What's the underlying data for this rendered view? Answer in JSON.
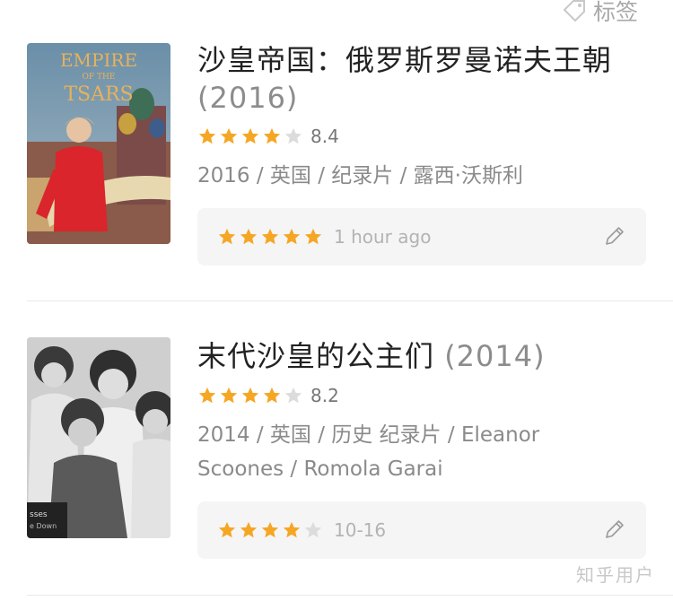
{
  "header": {
    "tag_label": "标签"
  },
  "items": [
    {
      "title": "沙皇帝国：俄罗斯罗曼诺夫王朝",
      "year": "(2016)",
      "rating_stars": 4,
      "score": "8.4",
      "meta": "2016 / 英国 / 纪录片 / 露西·沃斯利",
      "poster_text": {
        "line1": "EMPIRE",
        "line2": "OF THE",
        "line3": "TSARS"
      },
      "my_rating_stars": 5,
      "my_time": "1 hour ago"
    },
    {
      "title": "末代沙皇的公主们",
      "year": "(2014)",
      "rating_stars": 4,
      "score": "8.2",
      "meta": "2014 / 英国 / 历史 纪录片 / Eleanor Scoones / Romola Garai",
      "poster_text": {
        "line1": "sses",
        "line2": "e Down"
      },
      "my_rating_stars": 4,
      "my_time": "10-16"
    }
  ],
  "watermark": "知乎用户",
  "colors": {
    "star": "#f5a623",
    "star_empty": "#dcdcdc",
    "box_bg": "#f5f5f5"
  }
}
